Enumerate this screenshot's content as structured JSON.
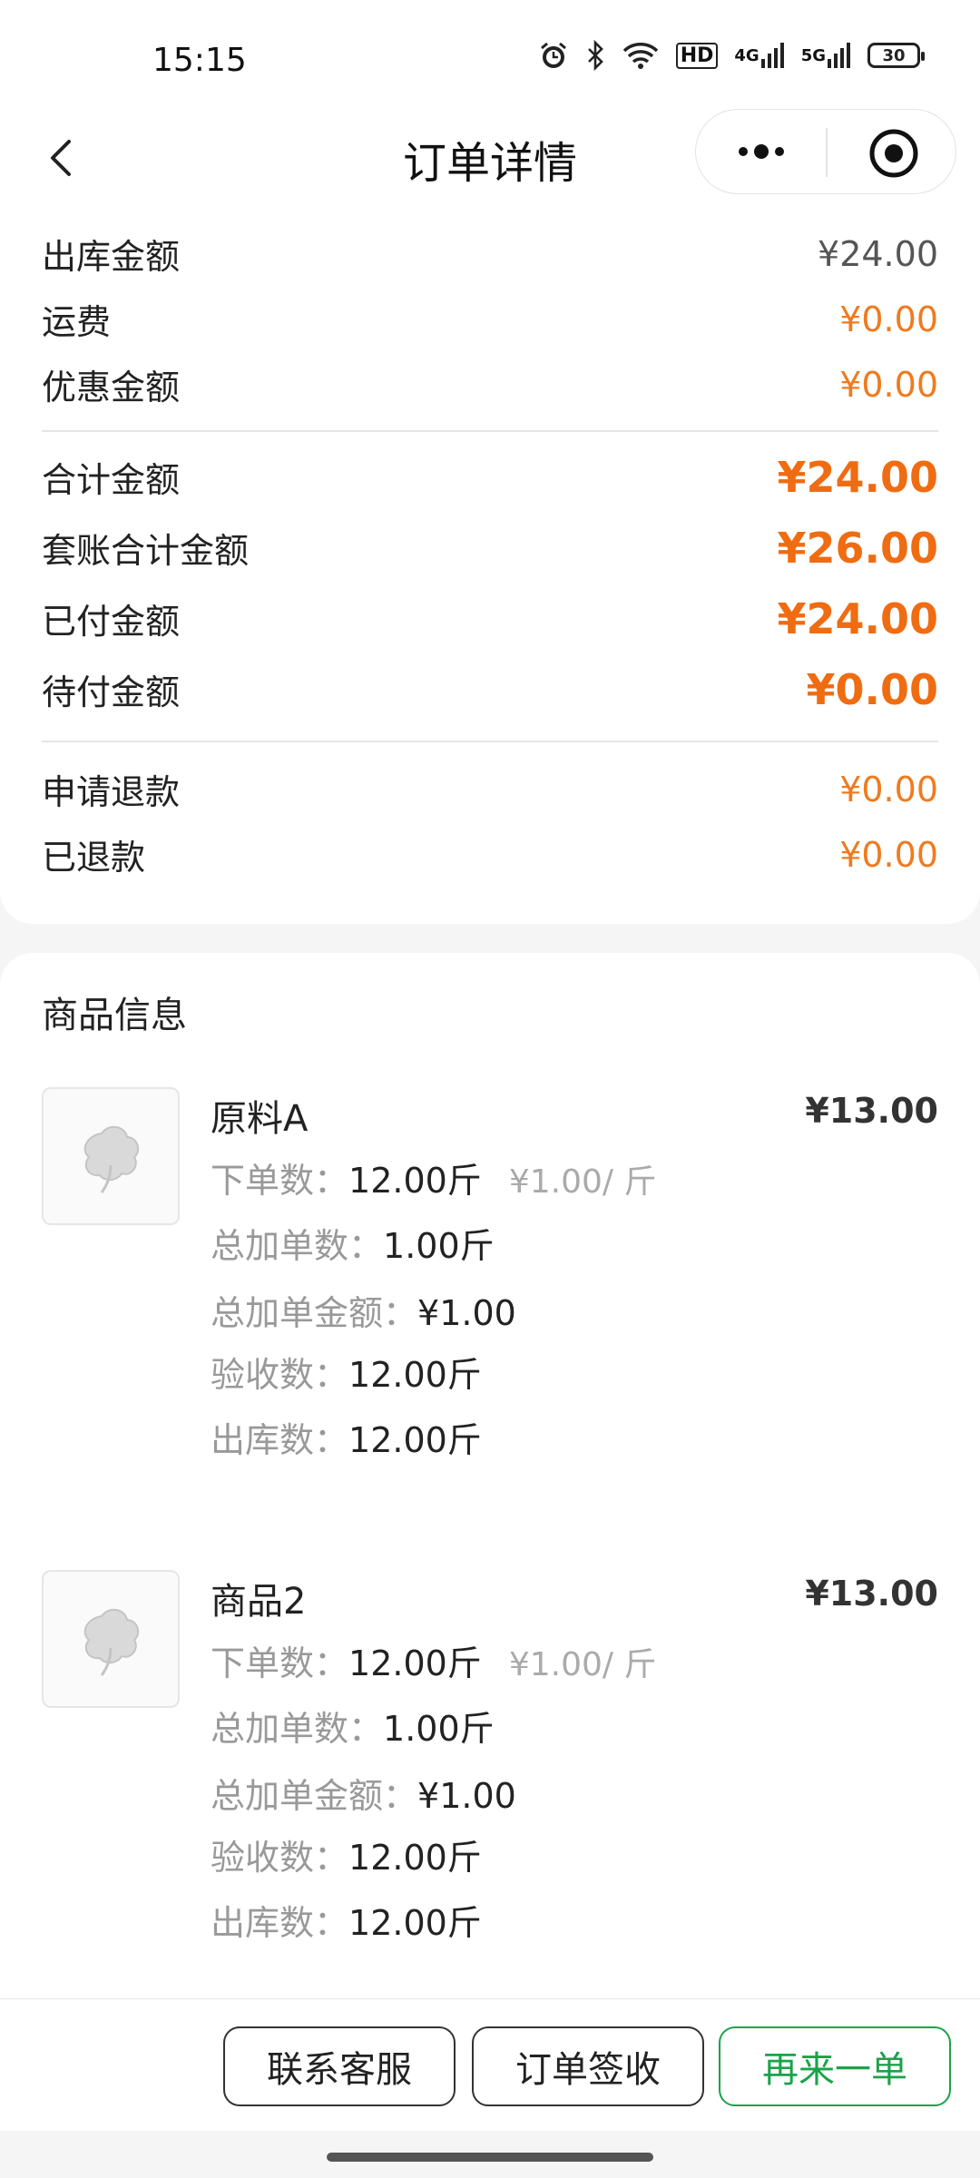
{
  "status": {
    "time": "15:15",
    "hd": "HD",
    "net1": "4G",
    "net2": "5G",
    "battery": "30"
  },
  "nav": {
    "title": "订单详情"
  },
  "summary": {
    "outbound_label": "出库金额",
    "outbound_value": "¥24.00",
    "freight_label": "运费",
    "freight_value": "¥0.00",
    "discount_label": "优惠金额",
    "discount_value": "¥0.00",
    "total_label": "合计金额",
    "total_value": "¥24.00",
    "package_total_label": "套账合计金额",
    "package_total_value": "¥26.00",
    "paid_label": "已付金额",
    "paid_value": "¥24.00",
    "unpaid_label": "待付金额",
    "unpaid_value": "¥0.00",
    "refund_apply_label": "申请退款",
    "refund_apply_value": "¥0.00",
    "refunded_label": "已退款",
    "refunded_value": "¥0.00"
  },
  "goods": {
    "section_title": "商品信息",
    "items": [
      {
        "name": "原料A",
        "price": "¥13.00",
        "order_qty_label": "下单数：",
        "order_qty": "12.00斤",
        "unit_price": "¥1.00/ 斤",
        "add_qty_label": "总加单数：",
        "add_qty": "1.00斤",
        "add_amount_label": "总加单金额：",
        "add_amount": "¥1.00",
        "check_qty_label": "验收数：",
        "check_qty": "12.00斤",
        "out_qty_label": "出库数：",
        "out_qty": "12.00斤"
      },
      {
        "name": "商品2",
        "price": "¥13.00",
        "order_qty_label": "下单数：",
        "order_qty": "12.00斤",
        "unit_price": "¥1.00/ 斤",
        "add_qty_label": "总加单数：",
        "add_qty": "1.00斤",
        "add_amount_label": "总加单金额：",
        "add_amount": "¥1.00",
        "check_qty_label": "验收数：",
        "check_qty": "12.00斤",
        "out_qty_label": "出库数：",
        "out_qty": "12.00斤"
      }
    ]
  },
  "actions": {
    "contact": "联系客服",
    "sign": "订单签收",
    "reorder": "再来一单"
  },
  "colors": {
    "accent_orange": "#ef6c12",
    "accent_green": "#1aa34a"
  }
}
